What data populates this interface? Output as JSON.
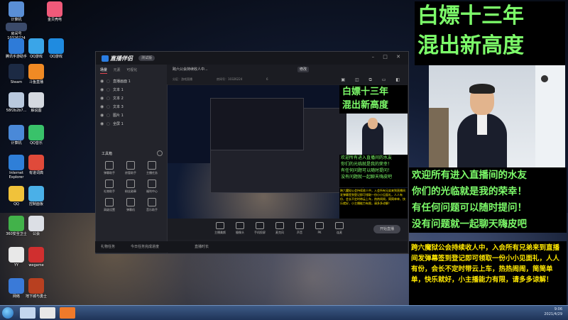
{
  "desktop": {
    "icons": [
      {
        "label": "计算机",
        "color": "#5a8fd6"
      },
      {
        "label": "金贝壳电",
        "color": "#f05a7a"
      },
      {
        "label": "腾讯手游助手",
        "color": "#2e7bd8"
      },
      {
        "label": "QQ游戏",
        "color": "#3aa5e8"
      },
      {
        "label": "QQ游戏",
        "color": "#1f8be0"
      },
      {
        "label": "Steam",
        "color": "#1c2a44"
      },
      {
        "label": "斗鱼直播",
        "color": "#f08a24"
      },
      {
        "label": "58f2b2b7...",
        "color": "#b9c9de"
      },
      {
        "label": "解说图",
        "color": "#d5d9e0"
      },
      {
        "label": "计算机",
        "color": "#4a89d8"
      },
      {
        "label": "QQ音乐",
        "color": "#39c26a"
      },
      {
        "label": "Internet Explorer",
        "color": "#2f7fd8"
      },
      {
        "label": "有道词典",
        "color": "#e04a3a"
      },
      {
        "label": "QQ",
        "color": "#f0c23a"
      },
      {
        "label": "控制面板",
        "color": "#4ab0e8"
      },
      {
        "label": "360安全卫士",
        "color": "#42b24a"
      },
      {
        "label": "公会",
        "color": "#dcdfe5"
      },
      {
        "label": "YY",
        "color": "#e8e8e8"
      },
      {
        "label": "wegame",
        "color": "#d02f2f"
      },
      {
        "label": "网络",
        "color": "#3a7ad8"
      },
      {
        "label": "地下城与勇士",
        "color": "#b84020"
      }
    ],
    "counter_text": "10326224",
    "room_label": "房间号"
  },
  "app": {
    "brand": "直播伴侣",
    "version_pill": "测试版",
    "window_controls": "– □ ✕",
    "side_tabs": [
      "场景",
      "元素",
      "可视化"
    ],
    "scenes": [
      {
        "name": "直播画面 1"
      },
      {
        "name": "文本 1"
      },
      {
        "name": "文本 2"
      },
      {
        "name": "文本 3"
      },
      {
        "name": "图片 1"
      },
      {
        "name": "全屏 1"
      }
    ],
    "tools_title": "工具箱",
    "tools": [
      "弹幕助手",
      "房管助手",
      "主播任务",
      "礼物助手",
      "粉丝勋章",
      "福利中心",
      "高级设置",
      "弹幕机",
      "音乐助手"
    ],
    "topbar_text": "跨六公会持续收人中...",
    "topbar_btn": "修改",
    "topbar2_left": "分区：游戏直播",
    "topbar2_mid": "房间号：10326224",
    "topbar2_right": "6",
    "bottom_items": [
      "主播美颜",
      "摄像头",
      "手机投屏",
      "麦克风",
      "声音",
      "PK",
      "连麦"
    ],
    "live_btn": "开始直播",
    "status_left": "礼物任务",
    "status_mid": "今日任务完成进度",
    "status_right": "直播时长"
  },
  "overlay": {
    "title_line1": "白嫖十三年",
    "title_line2": "混出新高度",
    "scroll_lines": [
      "欢迎所有进入直播间的水友",
      "你们的光临就是我的荣幸！",
      "有任何问题可以随时提问！",
      "没有问题就一起聊天嗨皮吧"
    ],
    "notice": "跨六魔狱公会持续收人中，入会所有兄弟来到直播间发弹幕签到登记即可领取一份小小见面礼，人人有份，会长不定时带云上车，热热闹闹，简简单单，快乐就好，小主播能力有限，请多多谅解！"
  },
  "taskbar": {
    "time": "9:06",
    "date": "2021/4/29"
  }
}
